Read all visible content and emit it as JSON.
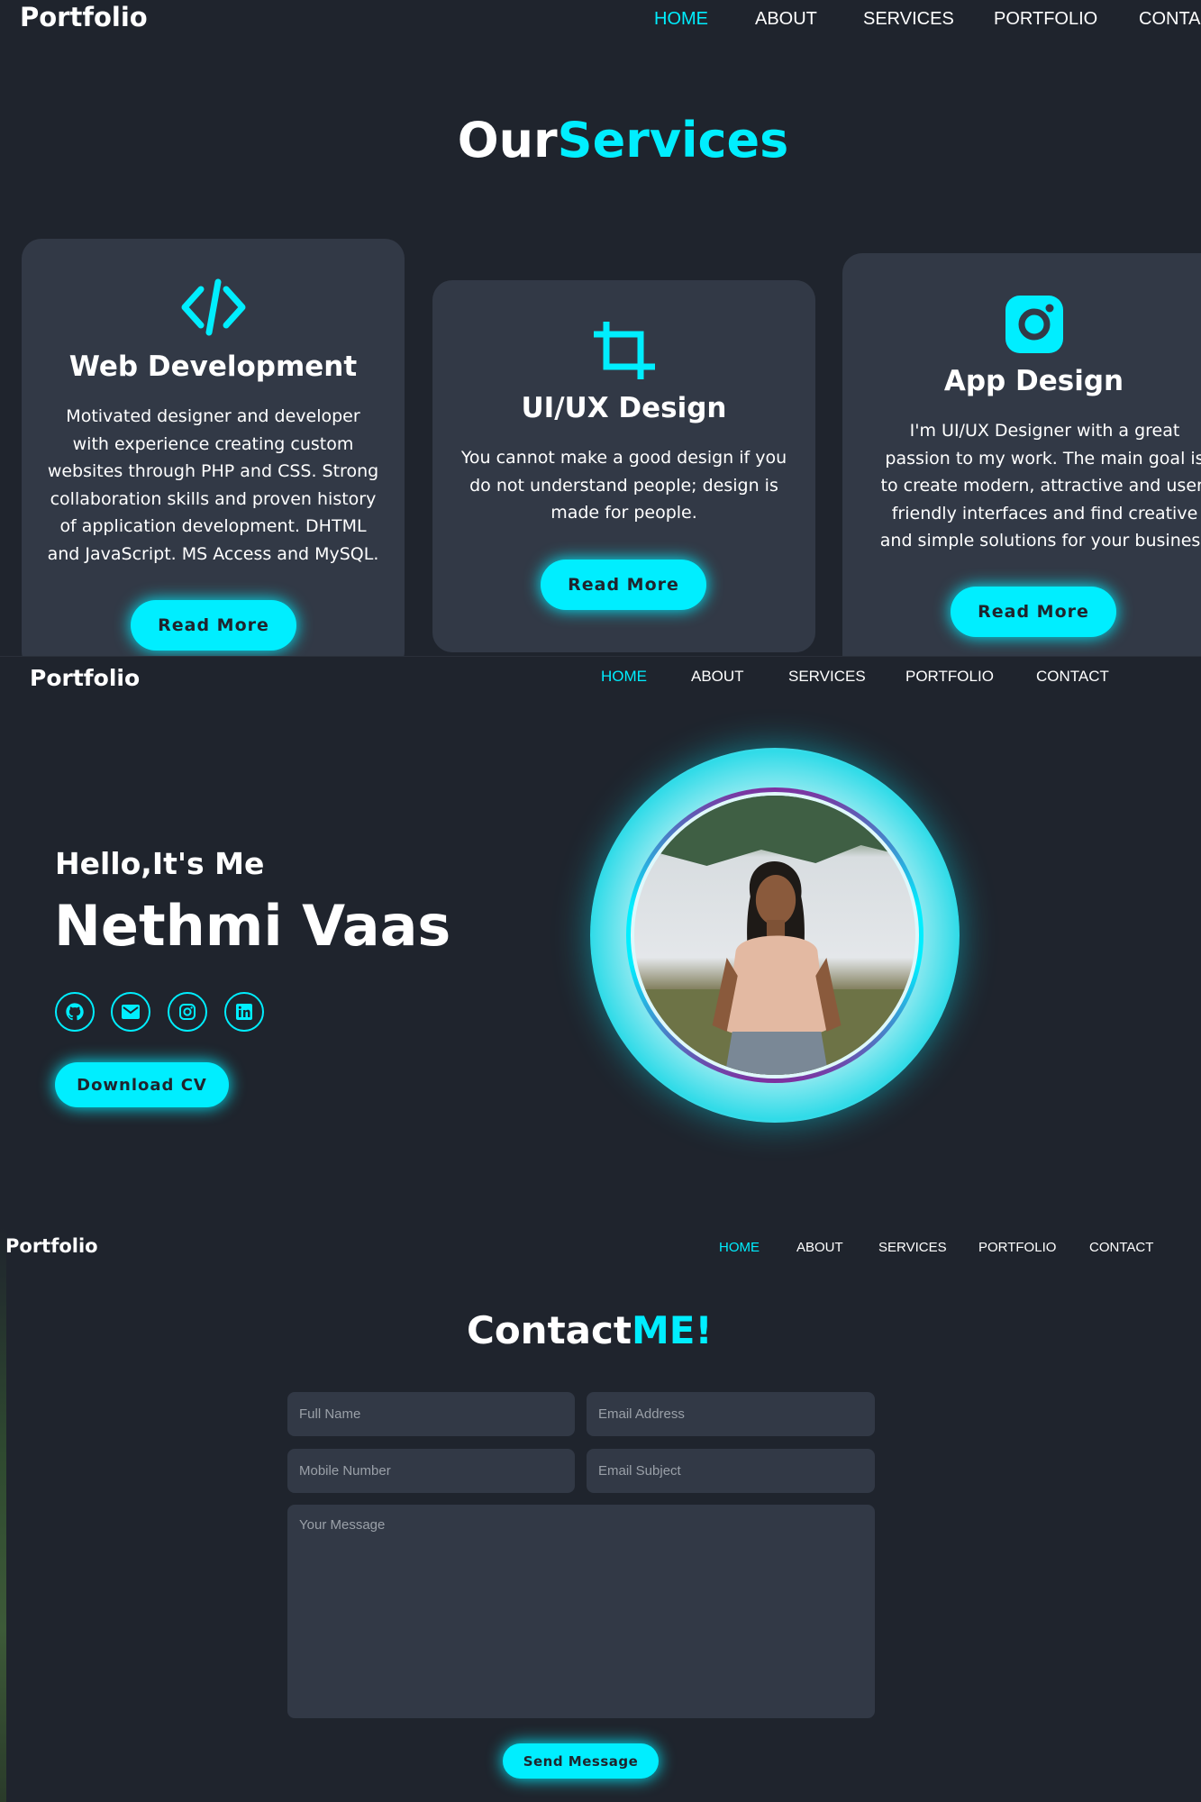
{
  "colors": {
    "background": "#1f242d",
    "card": "#323946",
    "accent": "#00eeff",
    "text": "#ffffff"
  },
  "services_section": {
    "nav": {
      "logo": "Portfolio",
      "links": [
        "HOME",
        "ABOUT",
        "SERVICES",
        "PORTFOLIO",
        "CONTA"
      ],
      "active": "HOME"
    },
    "heading_part1": "Our",
    "heading_part2": "Services",
    "cards": [
      {
        "icon": "code-icon",
        "title": "Web Development",
        "lines": [
          "Motivated designer and developer",
          "with experience creating custom",
          "websites through PHP and CSS. Strong",
          "collaboration skills and proven history",
          "of application development. DHTML",
          "and JavaScript. MS Access and MySQL."
        ],
        "button": "Read More"
      },
      {
        "icon": "crop-icon",
        "title": "UI/UX Design",
        "lines": [
          "You cannot make a good design if you",
          "do not understand people; design is",
          "made for people."
        ],
        "button": "Read More"
      },
      {
        "icon": "instagram-icon",
        "title": "App Design",
        "lines": [
          "I'm UI/UX Designer with a great",
          "passion to my work. The main goal is",
          "to create modern, attractive and user-",
          "friendly interfaces and find creative",
          "and simple solutions for your business"
        ],
        "button": "Read More"
      }
    ]
  },
  "home_section": {
    "nav": {
      "logo": "Portfolio",
      "links": [
        "HOME",
        "ABOUT",
        "SERVICES",
        "PORTFOLIO",
        "CONTACT"
      ],
      "active": "HOME"
    },
    "greeting": "Hello,It's Me",
    "name": "Nethmi Vaas",
    "socials": [
      "github-icon",
      "mail-icon",
      "instagram-icon",
      "linkedin-icon"
    ],
    "cta": "Download CV"
  },
  "contact_section": {
    "nav": {
      "logo": "Portfolio",
      "links": [
        "HOME",
        "ABOUT",
        "SERVICES",
        "PORTFOLIO",
        "CONTACT"
      ],
      "active": "HOME"
    },
    "heading_part1": "Contact",
    "heading_part2": "ME!",
    "form": {
      "full_name": "Full Name",
      "email": "Email Address",
      "mobile": "Mobile Number",
      "subject": "Email Subject",
      "message": "Your Message",
      "submit": "Send Message"
    }
  }
}
